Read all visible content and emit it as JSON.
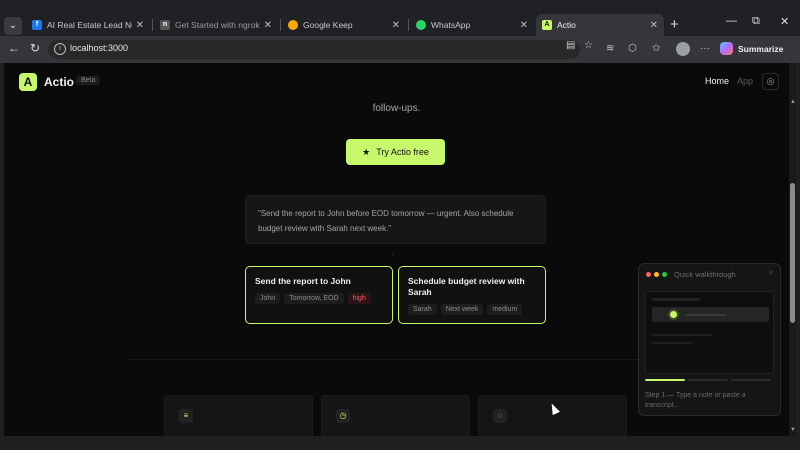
{
  "browser": {
    "tabs": [
      {
        "label": "AI Real Estate Lead Nurture",
        "favicon": "facebook-icon",
        "color": "#1877f2",
        "active": false
      },
      {
        "label": "Get Started with ngrok | Se",
        "favicon": "ngrok-icon",
        "color": "#555555",
        "active": false
      },
      {
        "label": "Google Keep",
        "favicon": "keep-icon",
        "color": "#f9ab00",
        "active": false
      },
      {
        "label": "WhatsApp",
        "favicon": "whatsapp-icon",
        "color": "#25d366",
        "active": false
      },
      {
        "label": "Actio",
        "favicon": "actio-icon",
        "color": "#c7f76a",
        "active": true
      }
    ],
    "url": "localhost:3000",
    "summarize_label": "Summarize"
  },
  "site": {
    "logo_letter": "A",
    "brand": "Actio",
    "badge": "Beta",
    "nav": {
      "home": "Home",
      "app": "App"
    },
    "hero_subtitle": "follow-ups.",
    "cta_label": "Try Actio free",
    "example_quote": "\"Send the report to John before EOD tomorrow — urgent. Also schedule budget review with Sarah next week.\"",
    "tasks": [
      {
        "title": "Send the report to John",
        "tags": [
          "John",
          "Tomorrow, EOD",
          "high"
        ],
        "priority_color": "#ff5a6a"
      },
      {
        "title": "Schedule budget review with Sarah",
        "tags": [
          "Sarah",
          "Next week",
          "medium"
        ]
      }
    ],
    "accent_color": "#c7f76a"
  },
  "walkthrough": {
    "title": "Quick walkthrough",
    "step_text": "Step 1 — Type a note or paste a transcript...",
    "step": 1,
    "steps_total": 3
  }
}
